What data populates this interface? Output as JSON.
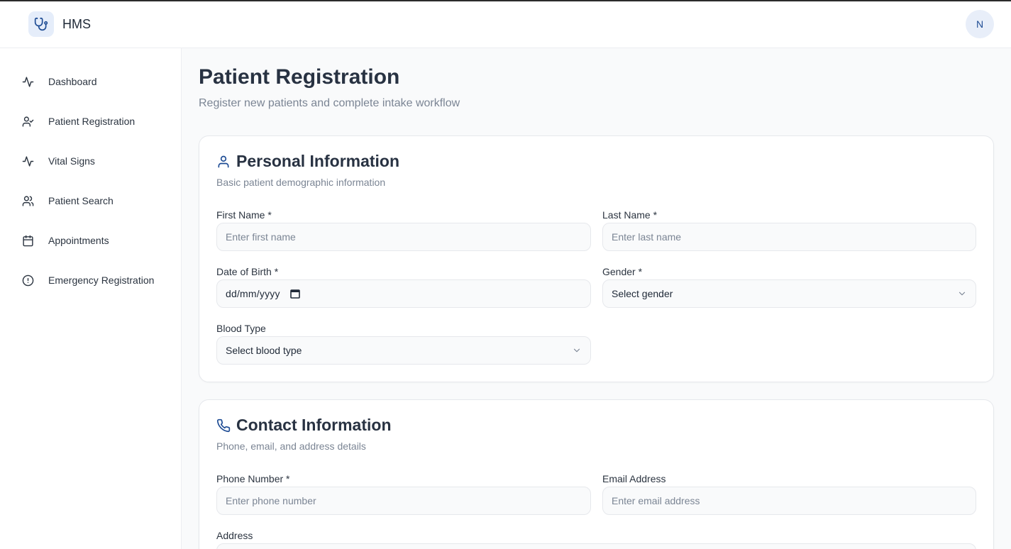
{
  "app": {
    "name": "HMS",
    "avatar_initial": "N"
  },
  "sidebar": {
    "items": [
      {
        "label": "Dashboard",
        "icon": "activity-icon"
      },
      {
        "label": "Patient Registration",
        "icon": "user-check-icon"
      },
      {
        "label": "Vital Signs",
        "icon": "activity-icon"
      },
      {
        "label": "Patient Search",
        "icon": "users-icon"
      },
      {
        "label": "Appointments",
        "icon": "calendar-icon"
      },
      {
        "label": "Emergency Registration",
        "icon": "alert-circle-icon"
      }
    ]
  },
  "page": {
    "title": "Patient Registration",
    "subtitle": "Register new patients and complete intake workflow"
  },
  "personal": {
    "title": "Personal Information",
    "subtitle": "Basic patient demographic information",
    "first_name": {
      "label": "First Name *",
      "placeholder": "Enter first name"
    },
    "last_name": {
      "label": "Last Name *",
      "placeholder": "Enter last name"
    },
    "dob": {
      "label": "Date of Birth *",
      "value": "dd/mm/yyyy"
    },
    "gender": {
      "label": "Gender *",
      "value": "Select gender"
    },
    "blood_type": {
      "label": "Blood Type",
      "value": "Select blood type"
    }
  },
  "contact": {
    "title": "Contact Information",
    "subtitle": "Phone, email, and address details",
    "phone": {
      "label": "Phone Number *",
      "placeholder": "Enter phone number"
    },
    "email": {
      "label": "Email Address",
      "placeholder": "Enter email address"
    },
    "address": {
      "label": "Address"
    }
  },
  "colors": {
    "accent": "#1e4c94",
    "accent_bg": "#e5edfa",
    "text": "#283242",
    "muted": "#7b8594"
  }
}
